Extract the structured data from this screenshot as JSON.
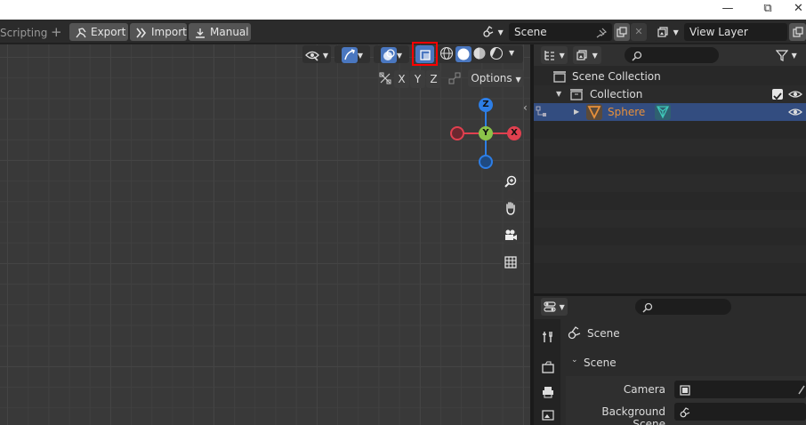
{
  "window": {
    "minimize_glyph": "—",
    "restore_glyph": "⧉",
    "close_glyph": "✕"
  },
  "topbar": {
    "workspace_tab": "Scripting",
    "add_tab_glyph": "+",
    "export_label": "Export",
    "import_label": "Import",
    "manual_label": "Manual",
    "scene_name": "Scene",
    "view_layer_name": "View Layer"
  },
  "viewport": {
    "axis_x": "X",
    "axis_y": "Y",
    "axis_z": "Z",
    "options_label": "Options",
    "gizmo": {
      "z_label": "Z",
      "y_label": "Y",
      "x_label": "X"
    },
    "nav_icons": [
      "zoom-icon",
      "hand-icon",
      "camera-icon",
      "grid-icon"
    ]
  },
  "outliner": {
    "search_placeholder": "",
    "rows": {
      "scene_collection": "Scene Collection",
      "collection": "Collection",
      "sphere": "Sphere"
    }
  },
  "properties": {
    "search_placeholder": "",
    "context_label": "Scene",
    "panel_title": "Scene",
    "camera_label": "Camera",
    "background_scene_label": "Background Scene"
  },
  "colors": {
    "accent_selected": "#334d80",
    "highlight_red": "#ff0000",
    "axis_x": "#e0404f",
    "axis_y": "#8bc34a",
    "axis_z": "#2d7ee6",
    "object_orange": "#e8903a",
    "mesh_teal": "#3ec7b8"
  }
}
